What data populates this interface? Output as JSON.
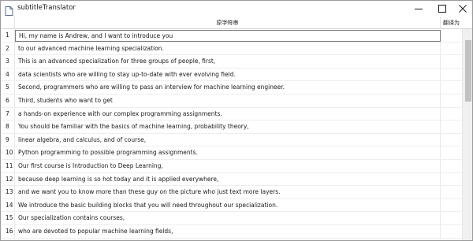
{
  "window": {
    "title": "subtitleTranslator"
  },
  "table": {
    "columns": [
      "原字符串",
      "翻译为"
    ],
    "rows": [
      {
        "num": "1",
        "text": "Hi, my name is Andrew, and I want to introduce you",
        "translation": ""
      },
      {
        "num": "2",
        "text": "to our advanced machine learning specialization.",
        "translation": ""
      },
      {
        "num": "3",
        "text": "This is an advanced specialization for three groups of people, first,",
        "translation": ""
      },
      {
        "num": "4",
        "text": "data scientists who are willing to stay up-to-date with ever evolving field.",
        "translation": ""
      },
      {
        "num": "5",
        "text": "Second, programmers who are willing to pass an interview for machine learning engineer.",
        "translation": ""
      },
      {
        "num": "6",
        "text": "Third, students who want to get",
        "translation": ""
      },
      {
        "num": "7",
        "text": "a hands-on experience with our complex programming assignments.",
        "translation": ""
      },
      {
        "num": "8",
        "text": "You should be familiar with the basics of machine learning, probability theory,",
        "translation": ""
      },
      {
        "num": "9",
        "text": "linear algebra, and calculus, and of course,",
        "translation": ""
      },
      {
        "num": "10",
        "text": "Python programming to possible programming assignments.",
        "translation": ""
      },
      {
        "num": "11",
        "text": "Our first course is Introduction to Deep Learning,",
        "translation": ""
      },
      {
        "num": "12",
        "text": "because deep learning is so hot today and it is applied everywhere,",
        "translation": ""
      },
      {
        "num": "13",
        "text": "and we want you to know more than these guy on the picture who just text more layers.",
        "translation": ""
      },
      {
        "num": "14",
        "text": "We introduce the basic building blocks that you will need throughout our specialization.",
        "translation": ""
      },
      {
        "num": "15",
        "text": "Our specialization contains courses,",
        "translation": ""
      },
      {
        "num": "16",
        "text": "who are devoted to popular machine learning fields,",
        "translation": ""
      }
    ]
  },
  "icons": {
    "app": "app-icon",
    "minimize": "minimize-icon",
    "maximize": "maximize-icon",
    "close": "close-icon",
    "sort": "sort-up-icon"
  }
}
